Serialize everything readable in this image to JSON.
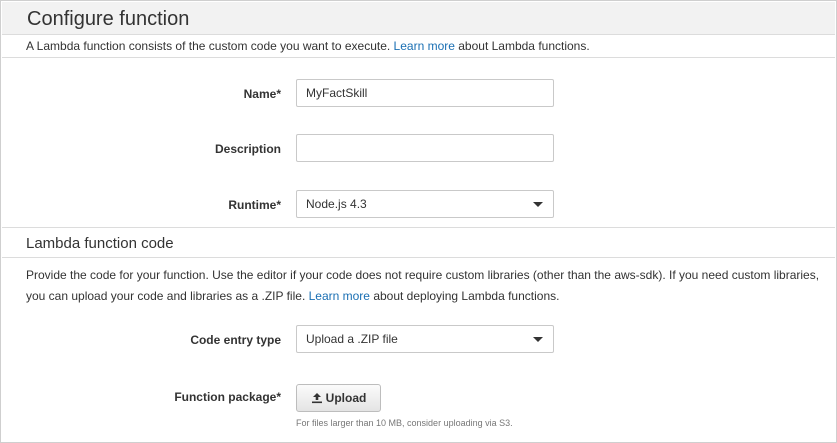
{
  "section1": {
    "title": "Configure function",
    "intro_prefix": "A Lambda function consists of the custom code you want to execute. ",
    "intro_link": "Learn more",
    "intro_suffix": " about Lambda functions."
  },
  "form": {
    "name_label": "Name*",
    "name_value": "MyFactSkill",
    "description_label": "Description",
    "description_value": "",
    "runtime_label": "Runtime*",
    "runtime_value": "Node.js 4.3"
  },
  "section2": {
    "title": "Lambda function code",
    "desc_prefix": "Provide the code for your function. Use the editor if your code does not require custom libraries (other than the aws-sdk). If you need custom libraries, you can upload your code and libraries as a .ZIP file. ",
    "desc_link": "Learn more",
    "desc_suffix": " about deploying Lambda functions.",
    "code_entry_label": "Code entry type",
    "code_entry_value": "Upload a .ZIP file",
    "package_label": "Function package*",
    "upload_label": "Upload",
    "upload_hint": "For files larger than 10 MB, consider uploading via S3."
  },
  "icons": {
    "upload": "upload-icon",
    "select_caret": "chevron-down-icon"
  },
  "colors": {
    "link": "#1a6fb3",
    "header_bg": "#f2f2f2"
  }
}
